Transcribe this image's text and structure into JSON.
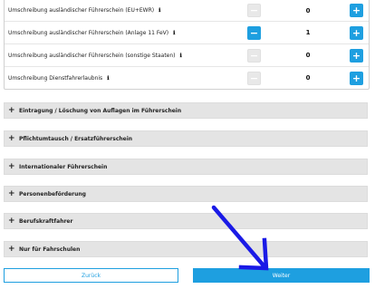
{
  "services": [
    {
      "label": "Umschreibung ausländischer Führerschein (EU+EWR)",
      "quantity": "0",
      "minus_enabled": false
    },
    {
      "label": "Umschreibung ausländischer Führerschein (Anlage 11 FeV)",
      "quantity": "1",
      "minus_enabled": true
    },
    {
      "label": "Umschreibung ausländischer Führerschein (sonstige Staaten)",
      "quantity": "0",
      "minus_enabled": false
    },
    {
      "label": "Umschreibung Dienstfahrerlaubnis",
      "quantity": "0",
      "minus_enabled": false
    }
  ],
  "symbols": {
    "minus": "−",
    "plus": "+",
    "info": "ℹ",
    "expand": "+"
  },
  "accordion": [
    {
      "label": "Eintragung / Löschung von Auflagen im Führerschein"
    },
    {
      "label": "Pflichtumtausch / Ersatzführerschein"
    },
    {
      "label": "Internationaler Führerschein"
    },
    {
      "label": "Personenbeförderung"
    },
    {
      "label": "Berufskraftfahrer"
    },
    {
      "label": "Nur für Fahrschulen"
    }
  ],
  "nav": {
    "back_label": "Zurück",
    "next_label": "Weiter"
  },
  "colors": {
    "accent": "#1e9fe0",
    "annotation_arrow": "#1a1ae6"
  }
}
